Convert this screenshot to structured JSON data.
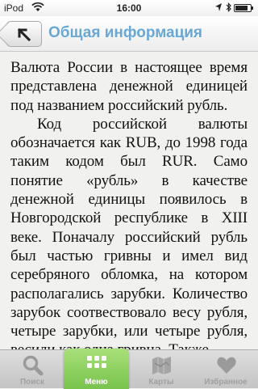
{
  "status_bar": {
    "carrier": "iPod",
    "time": "16:00"
  },
  "nav": {
    "title": "Общая информация"
  },
  "article": {
    "paragraph_1": "Валюта России в настоящее время представлена денежной единицей под названием российский рубль.",
    "paragraph_2": "Код российской валюты обозначается как RUB, до 1998 года таким кодом был RUR. Само понятие «рубль» в качестве денежной единицы появилось в Новгородской республике в XIII веке. Поначалу российский рубль был частью гривны и имел вид серебряного обломка, на котором располагались зарубки. Количество зарубок соотвествовало весу рубля, четыре зарубки, или четыре рубля, весили как одна гривна. Также"
  },
  "tab_bar": {
    "tabs": [
      {
        "label": "Поиск",
        "icon": "search-icon"
      },
      {
        "label": "Меню",
        "icon": "grid-menu-icon",
        "active": true
      },
      {
        "label": "Карты",
        "icon": "map-icon"
      },
      {
        "label": "Избранное",
        "icon": "heart-icon"
      }
    ]
  },
  "colors": {
    "title": "#6aa8d4",
    "active_tab": "#8fd060",
    "inactive_tab_label": "#a0a0a0"
  }
}
